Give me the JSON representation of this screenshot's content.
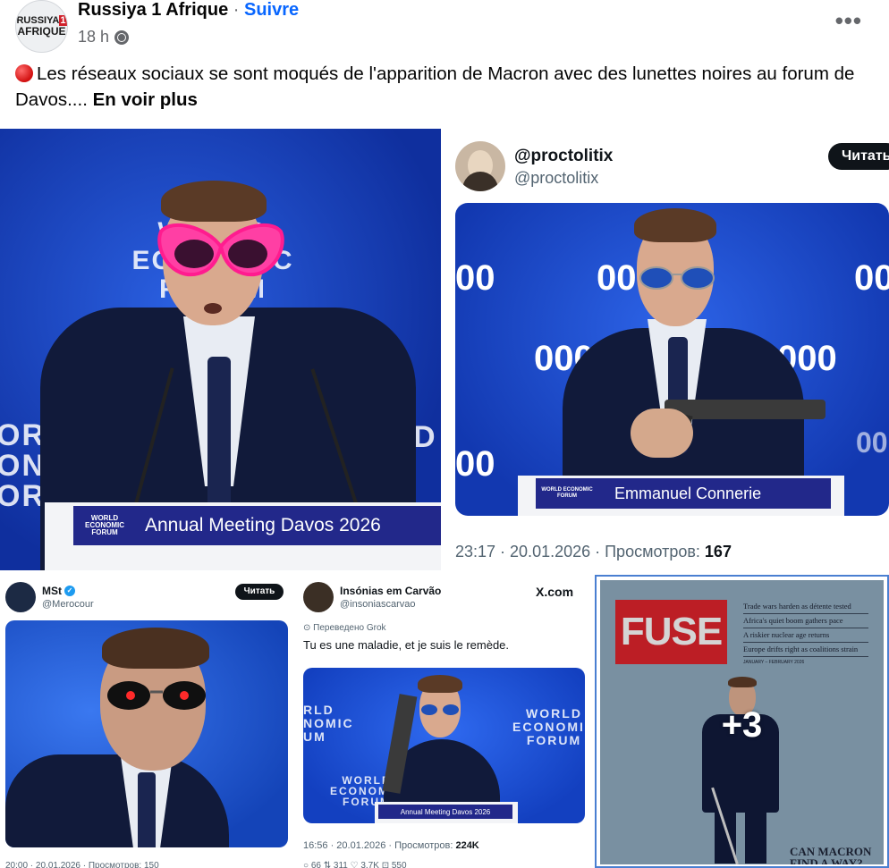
{
  "header": {
    "avatar_line1": "RUSSIYA",
    "avatar_line1_badge": "1",
    "avatar_line2": "AFRIQUE",
    "page_name": "Russiya 1 Afrique",
    "separator": "·",
    "follow_label": "Suivre",
    "time": "18 h",
    "more_label": "•••"
  },
  "post": {
    "text": "Les réseaux sociaux se sont moqués de l'apparition de Macron avec des lunettes noires au forum de Davos....",
    "see_more": "En voir plus"
  },
  "tile1": {
    "bg_line1": "WORLD",
    "bg_line2": "ECONOMIC",
    "bg_line3": "FORUM",
    "side_line1": "ORLD",
    "side_line2": "ONOMI",
    "side_line3": "ORU",
    "side_right": "D",
    "podium_logo": "WORLD ECONOMIC FORUM",
    "podium_text": "Annual Meeting Davos 2026"
  },
  "tile2": {
    "name": "@proctolitix",
    "handle": "@proctolitix",
    "read_button": "Читать",
    "numbers": [
      "00",
      "000",
      "00",
      "0000",
      "000",
      "00",
      "00",
      "00"
    ],
    "podium_logo": "WORLD ECONOMIC FORUM",
    "podium_text": "Emmanuel Connerie",
    "meta_time": "23:17 · 20.01.2026 · Просмотров:",
    "meta_views": "167"
  },
  "tile3": {
    "name": "MSt",
    "handle": "@Merocour",
    "read_button": "Читать",
    "meta": "20:00 · 20.01.2026 · Просмотров: 150"
  },
  "tile4": {
    "name": "Insónias em Carvão",
    "handle": "@insoniascarvao",
    "site": "X.com",
    "translated": "Переведено Grok",
    "text": "Tu es une maladie, et je suis le remède.",
    "img_left1": "RLD",
    "img_left2": "NOMIC",
    "img_left3": "UM",
    "img_right1": "WORLD",
    "img_right2": "ECONOMIC",
    "img_right3": "FORUM",
    "img_bottom1": "WORLD",
    "img_bottom2": "ECONOMIC",
    "img_bottom3": "FORUM",
    "podium_text": "Annual Meeting Davos 2026",
    "meta_time": "16:56 · 20.01.2026 · Просмотров:",
    "meta_views": "224K",
    "actions": "○ 66     ⇅ 311     ♡ 3.7K     ⊡ 550"
  },
  "tile5": {
    "masthead": "FUSE",
    "headlines": [
      "Trade wars harden as détente tested",
      "Africa's quiet boom gathers pace",
      "A riskier nuclear age returns",
      "Europe drifts right as coalitions strain"
    ],
    "date": "JANUARY – FEBRUARY 2026",
    "more_count": "+3",
    "cover_line1": "CAN MACRON",
    "cover_line2": "FIND A WAY?"
  },
  "colors": {
    "facebook_blue": "#0866ff",
    "wef_blue": "#1d4fd6",
    "fuse_red": "#d7232b",
    "selection_border": "#4a7fd1"
  }
}
